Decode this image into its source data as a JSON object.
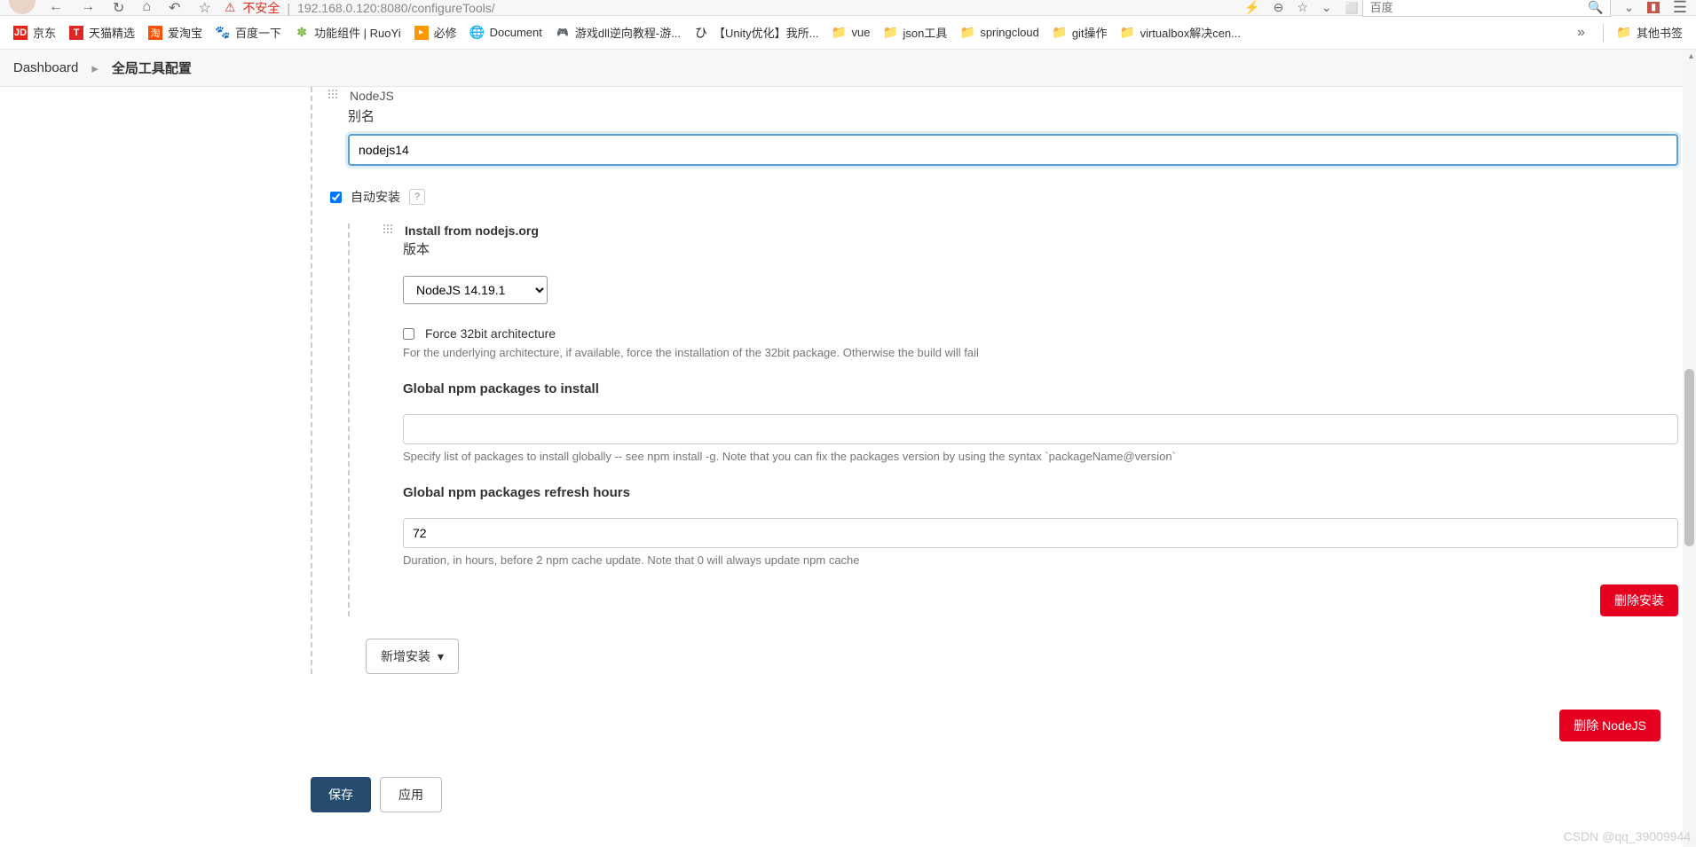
{
  "browser": {
    "insecure_label": "不安全",
    "url": "192.168.0.120:8080/configureTools/",
    "search_placeholder": "百度"
  },
  "bookmarks": {
    "items": [
      {
        "label": "京东",
        "icon": "JD"
      },
      {
        "label": "天猫精选",
        "icon": "T"
      },
      {
        "label": "爱淘宝",
        "icon": "淘"
      },
      {
        "label": "百度一下",
        "icon": "paw"
      },
      {
        "label": "功能组件 | RuoYi",
        "icon": "leaf"
      },
      {
        "label": "必修",
        "icon": "▸"
      },
      {
        "label": "Document",
        "icon": "globe"
      },
      {
        "label": "游戏dll逆向教程-游...",
        "icon": "game"
      },
      {
        "label": "【Unity优化】我所...",
        "icon": "unity"
      },
      {
        "label": "vue",
        "icon": "folder"
      },
      {
        "label": "json工具",
        "icon": "folder"
      },
      {
        "label": "springcloud",
        "icon": "folder"
      },
      {
        "label": "git操作",
        "icon": "folder"
      },
      {
        "label": "virtualbox解决cen...",
        "icon": "folder"
      }
    ],
    "other_label": "其他书签"
  },
  "breadcrumb": {
    "dashboard": "Dashboard",
    "current": "全局工具配置"
  },
  "form": {
    "nodejs_label": "NodeJS",
    "alias_label": "别名",
    "alias_value": "nodejs14",
    "auto_install_label": "自动安装",
    "install_from_label": "Install from nodejs.org",
    "version_label": "版本",
    "version_value": "NodeJS 14.19.1",
    "force32_label": "Force 32bit architecture",
    "force32_help": "For the underlying architecture, if available, force the installation of the 32bit package. Otherwise the build will fail",
    "global_packages_label": "Global npm packages to install",
    "global_packages_value": "",
    "global_packages_help": "Specify list of packages to install globally -- see npm install -g. Note that you can fix the packages version by using the syntax `packageName@version`",
    "refresh_hours_label": "Global npm packages refresh hours",
    "refresh_hours_value": "72",
    "refresh_hours_help": "Duration, in hours, before 2 npm cache update. Note that 0 will always update npm cache",
    "delete_install_label": "删除安装",
    "add_install_label": "新增安装",
    "delete_nodejs_label": "删除 NodeJS",
    "save_label": "保存",
    "apply_label": "应用"
  },
  "watermark": "CSDN @qq_39009944"
}
